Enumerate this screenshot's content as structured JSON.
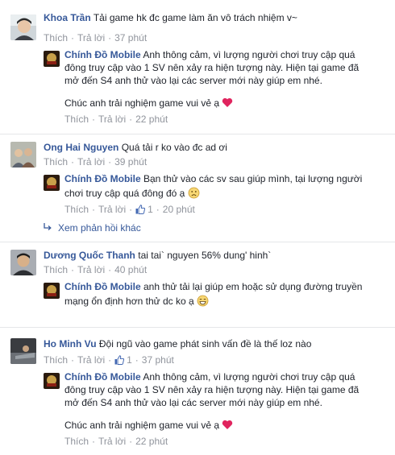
{
  "comments": [
    {
      "author": "Khoa Trần",
      "text": "Tải game hk đc game làm ăn vô trách nhiệm v~",
      "like": "Thích",
      "reply": "Trả lời",
      "time": "37 phút",
      "reply_block": {
        "author": "Chính Đồ Mobile",
        "lines": [
          "Anh thông cảm, vì lượng người chơi truy cập quá",
          "đông truy cập vào 1 SV nên xảy ra hiện tượng này. Hiện tại game đã",
          "mở đến S4 anh thử vào lại các server mới này giúp em nhé."
        ],
        "closing": "Chúc anh trải nghiệm game vui vẻ ạ",
        "emoji": "heart-icon",
        "like": "Thích",
        "reply": "Trả lời",
        "time": "22 phút"
      }
    },
    {
      "author": "Ong Hai Nguyen",
      "text": "Quá tải r ko vào đc ad ơi",
      "like": "Thích",
      "reply": "Trả lời",
      "time": "39 phút",
      "reply_block": {
        "author": "Chính Đồ Mobile",
        "lines": [
          "Bạn thử vào các sv sau giúp mình, tại lượng người",
          "chơi truy cập quá đông đó ạ"
        ],
        "emoji": "sad-face-icon",
        "like": "Thích",
        "reply": "Trả lời",
        "likes": "1",
        "time": "20 phút"
      },
      "more_replies": "Xem phản hồi khác"
    },
    {
      "author": "Dương Quốc Thanh",
      "text": "tai tai` nguyen 56% dung' hinh`",
      "like": "Thích",
      "reply": "Trả lời",
      "time": "40 phút",
      "reply_block": {
        "author": "Chính Đồ Mobile",
        "lines": [
          "anh thử tải lại giúp em hoặc sử dụng đường truyền",
          "mạng ổn định hơn thử dc ko ạ"
        ],
        "emoji": "grin-face-icon"
      }
    },
    {
      "author": "Ho Minh Vu",
      "text": "Đội ngũ vào game phát sinh vấn đề là thế loz nào",
      "like": "Thích",
      "reply": "Trả lời",
      "likes": "1",
      "time": "37 phút",
      "reply_block": {
        "author": "Chính Đồ Mobile",
        "lines": [
          "Anh thông cảm, vì lượng người chơi truy cập quá",
          "đông truy cập vào 1 SV nên xảy ra hiện tượng này. Hiện tại game đã",
          "mở đến S4 anh thử vào lại các server mới này giúp em nhé."
        ],
        "closing": "Chúc anh trải nghiệm game vui vẻ ạ",
        "emoji": "heart-icon",
        "like": "Thích",
        "reply": "Trả lời",
        "time": "22 phút"
      }
    }
  ],
  "colors": {
    "name": "#365899",
    "meta": "#90949c",
    "text": "#1d2129",
    "separator": "#e5e6e9",
    "heart": "#e0245e",
    "like_blue": "#4267b2"
  }
}
